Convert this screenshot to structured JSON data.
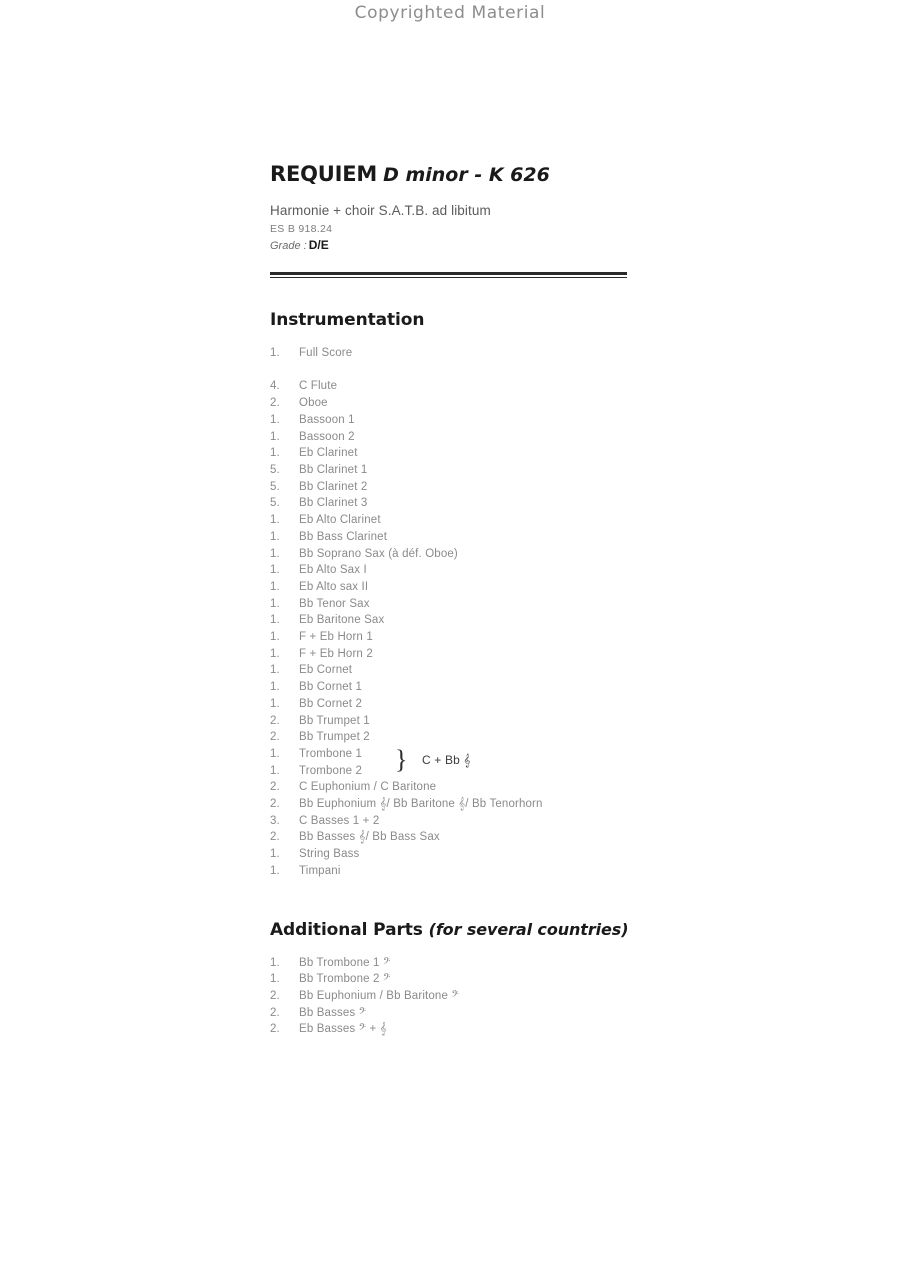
{
  "banner": {
    "text": "Copyrighted Material"
  },
  "title": {
    "main": "REQUIEM",
    "subtitle": "D minor - K 626"
  },
  "header": {
    "ensemble": "Harmonie + choir S.A.T.B. ad libitum",
    "catalog": "ES B 918.24",
    "grade_label": "Grade :",
    "grade_value": "D/E"
  },
  "instrumentation": {
    "heading": "Instrumentation",
    "score": [
      {
        "qty": "1.",
        "name": "Full Score"
      }
    ],
    "parts": [
      {
        "qty": "4.",
        "name": "C Flute"
      },
      {
        "qty": "2.",
        "name": "Oboe"
      },
      {
        "qty": "1.",
        "name": "Bassoon 1"
      },
      {
        "qty": "1.",
        "name": "Bassoon 2"
      },
      {
        "qty": "1.",
        "name": "Eb Clarinet"
      },
      {
        "qty": "5.",
        "name": "Bb Clarinet 1"
      },
      {
        "qty": "5.",
        "name": "Bb Clarinet 2"
      },
      {
        "qty": "5.",
        "name": "Bb Clarinet 3"
      },
      {
        "qty": "1.",
        "name": "Eb Alto Clarinet"
      },
      {
        "qty": "1.",
        "name": "Bb Bass Clarinet"
      },
      {
        "qty": "1.",
        "name": "Bb Soprano Sax (à déf. Oboe)"
      },
      {
        "qty": "1.",
        "name": "Eb Alto Sax I"
      },
      {
        "qty": "1.",
        "name": "Eb Alto sax II"
      },
      {
        "qty": "1.",
        "name": "Bb Tenor Sax"
      },
      {
        "qty": "1.",
        "name": "Eb Baritone Sax"
      },
      {
        "qty": "1.",
        "name": "F + Eb Horn 1"
      },
      {
        "qty": "1.",
        "name": "F + Eb Horn 2"
      },
      {
        "qty": "1.",
        "name": "Eb Cornet"
      },
      {
        "qty": "1.",
        "name": "Bb Cornet 1"
      },
      {
        "qty": "1.",
        "name": "Bb Cornet 2"
      },
      {
        "qty": "2.",
        "name": "Bb Trumpet 1"
      },
      {
        "qty": "2.",
        "name": "Bb Trumpet 2"
      },
      {
        "qty": "1.",
        "name": "Trombone 1"
      },
      {
        "qty": "1.",
        "name": "Trombone 2"
      },
      {
        "qty": "2.",
        "name": "C Euphonium / C Baritone"
      },
      {
        "qty": "2.",
        "name": "Bb Euphonium 𝄞/ Bb Baritone 𝄞/ Bb Tenorhorn"
      },
      {
        "qty": "3.",
        "name": "C Basses 1  + 2"
      },
      {
        "qty": "2.",
        "name": "Bb Basses 𝄞/ Bb Bass Sax"
      },
      {
        "qty": "1.",
        "name": "String Bass"
      },
      {
        "qty": "1.",
        "name": "Timpani"
      }
    ],
    "brace_note": "C + Bb 𝄞"
  },
  "additional": {
    "heading_main": "Additional Parts",
    "heading_note": "(for several countries)",
    "parts": [
      {
        "qty": "1.",
        "name": "Bb Trombone 1 𝄢"
      },
      {
        "qty": "1.",
        "name": "Bb Trombone 2 𝄢"
      },
      {
        "qty": "2.",
        "name": "Bb Euphonium / Bb Baritone  𝄢"
      },
      {
        "qty": "2.",
        "name": "Bb Basses  𝄢"
      },
      {
        "qty": "2.",
        "name": "Eb Basses 𝄢 + 𝄞"
      }
    ]
  }
}
